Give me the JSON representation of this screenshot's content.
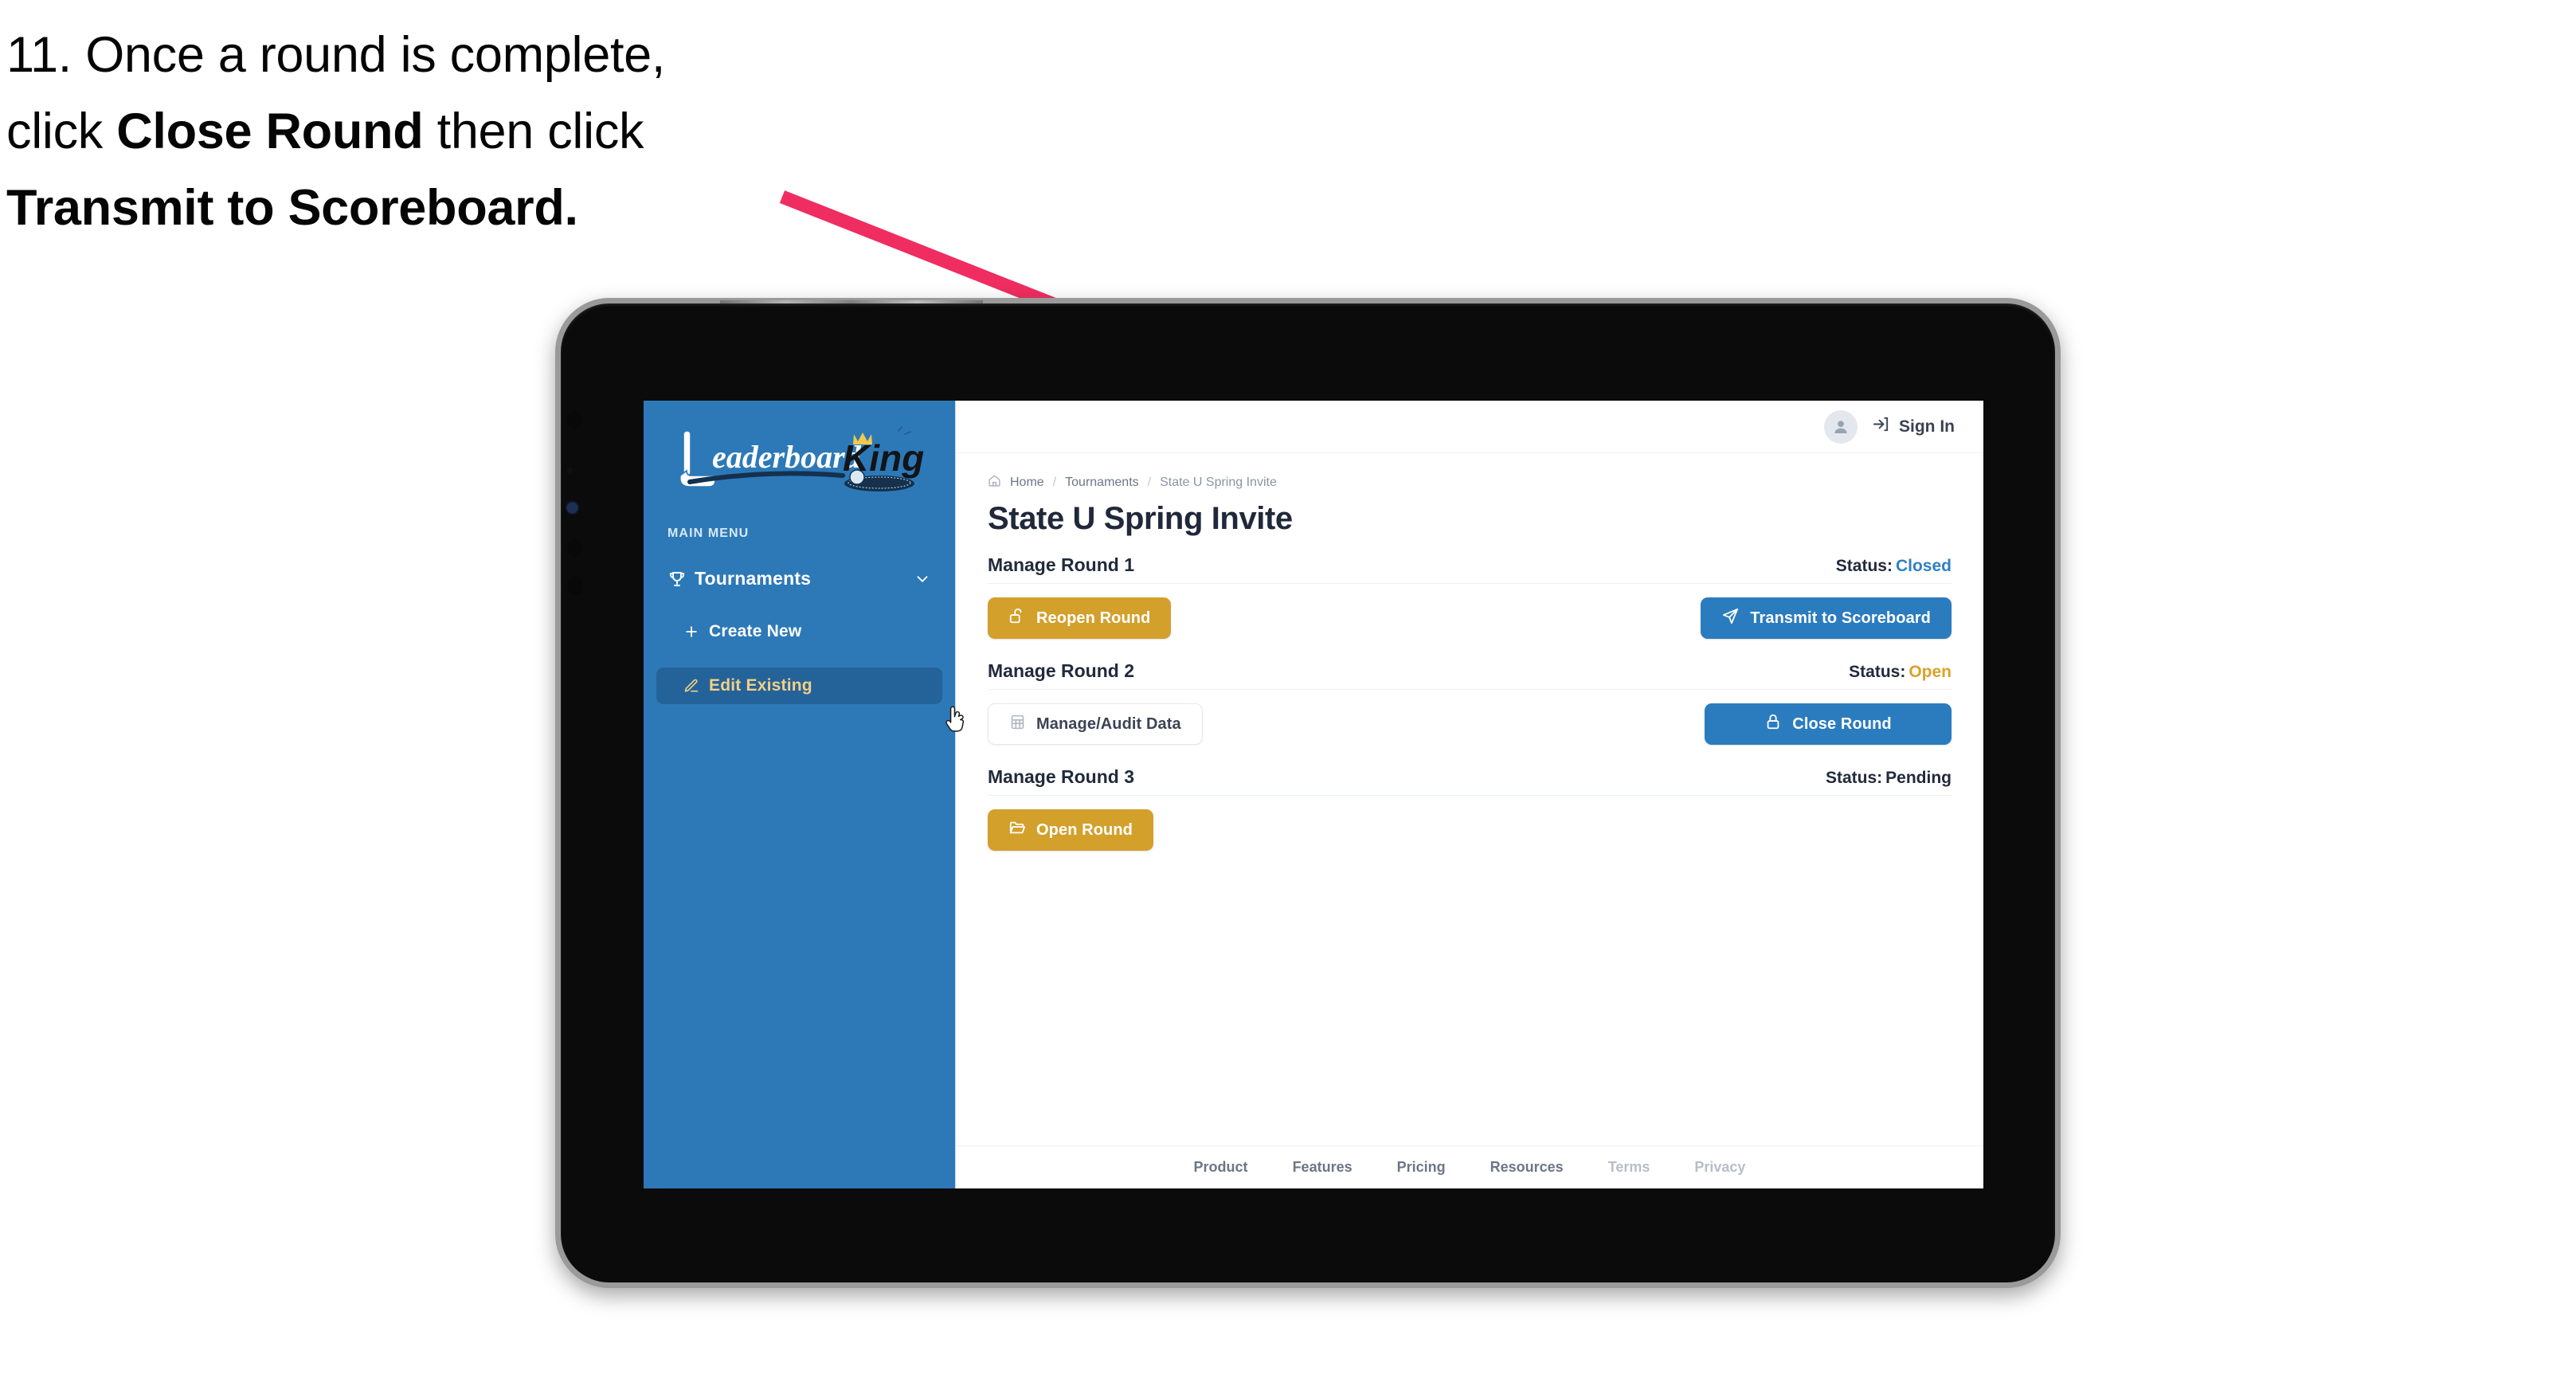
{
  "caption": {
    "line1": "11. Once a round is complete,",
    "line2_pre": "click ",
    "line2_bold": "Close Round",
    "line2_post": " then click",
    "line3_bold": "Transmit to Scoreboard."
  },
  "colors": {
    "arrow": "#ef2d61",
    "sidebar": "#2d79b8",
    "sidebar_active": "#246399",
    "accent_gold": "#d3a02c",
    "accent_blue": "#2b7cbf",
    "status_closed": "#2f7fc4",
    "status_open": "#d9a22b",
    "status_pending": "#222a3c"
  },
  "sidebar": {
    "logo_primary": "Leaderboard",
    "logo_secondary": "King",
    "menu_label": "MAIN MENU",
    "items": [
      {
        "label": "Tournaments",
        "icon": "trophy-icon",
        "chevron": "chevron-down-icon",
        "active": false
      },
      {
        "label": "Create New",
        "icon": "plus-icon",
        "active": false
      },
      {
        "label": "Edit Existing",
        "icon": "edit-pencil-icon",
        "active": true
      }
    ]
  },
  "topbar": {
    "avatar_icon": "user-avatar-icon",
    "signin_icon": "sign-in-arrow-icon",
    "signin_label": "Sign In"
  },
  "breadcrumb": {
    "home_icon": "home-icon",
    "items": [
      "Home",
      "Tournaments",
      "State U Spring Invite"
    ],
    "separator": "/"
  },
  "page": {
    "title": "State U Spring Invite"
  },
  "rounds": [
    {
      "name": "Manage Round 1",
      "status_label": "Status:",
      "status_value": "Closed",
      "status_class": "closed",
      "left_button": {
        "label": "Reopen Round",
        "icon": "unlock-icon",
        "style": "gold"
      },
      "right_button": {
        "label": "Transmit to Scoreboard",
        "icon": "paper-plane-icon",
        "style": "blue"
      }
    },
    {
      "name": "Manage Round 2",
      "status_label": "Status:",
      "status_value": "Open",
      "status_class": "open",
      "left_button": {
        "label": "Manage/Audit Data",
        "icon": "grid-table-icon",
        "style": "ghost"
      },
      "right_button": {
        "label": "Close Round",
        "icon": "lock-icon",
        "style": "blue"
      }
    },
    {
      "name": "Manage Round 3",
      "status_label": "Status:",
      "status_value": "Pending",
      "status_class": "pending",
      "left_button": {
        "label": "Open Round",
        "icon": "folder-open-icon",
        "style": "gold"
      },
      "right_button": null
    }
  ],
  "footer": {
    "links": [
      {
        "label": "Product",
        "dim": false
      },
      {
        "label": "Features",
        "dim": false
      },
      {
        "label": "Pricing",
        "dim": false
      },
      {
        "label": "Resources",
        "dim": false
      },
      {
        "label": "Terms",
        "dim": true
      },
      {
        "label": "Privacy",
        "dim": true
      }
    ]
  }
}
